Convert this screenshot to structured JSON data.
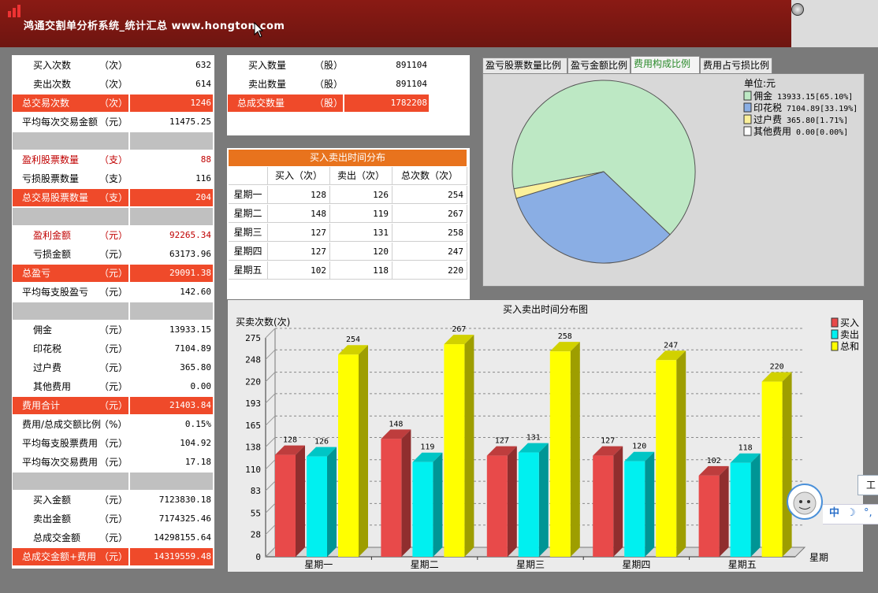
{
  "app": {
    "title": "鸿通交割单分析系统_统计汇总 www.hongton.com"
  },
  "stats": [
    {
      "label": "买入次数",
      "unit": "（次）",
      "value": "632",
      "style": "normal"
    },
    {
      "label": "卖出次数",
      "unit": "（次）",
      "value": "614",
      "style": "normal"
    },
    {
      "label": "总交易次数",
      "unit": "（次）",
      "value": "1246",
      "style": "highlight"
    },
    {
      "label": "平均每次交易金额",
      "unit": "（元）",
      "value": "11475.25",
      "style": "normal"
    },
    {
      "label": "",
      "unit": "",
      "value": "",
      "style": "sep"
    },
    {
      "label": "盈利股票数量",
      "unit": "（支）",
      "value": "88",
      "style": "red"
    },
    {
      "label": "亏损股票数量",
      "unit": "（支）",
      "value": "116",
      "style": "normal"
    },
    {
      "label": "总交易股票数量",
      "unit": "（支）",
      "value": "204",
      "style": "highlight"
    },
    {
      "label": "",
      "unit": "",
      "value": "",
      "style": "sep"
    },
    {
      "label": "盈利金额",
      "unit": "（元）",
      "value": "92265.34",
      "style": "red"
    },
    {
      "label": "亏损金额",
      "unit": "（元）",
      "value": "63173.96",
      "style": "normal"
    },
    {
      "label": "总盈亏",
      "unit": "（元）",
      "value": "29091.38",
      "style": "highlight"
    },
    {
      "label": "平均每支股盈亏",
      "unit": "（元）",
      "value": "142.60",
      "style": "normal"
    },
    {
      "label": "",
      "unit": "",
      "value": "",
      "style": "sep"
    },
    {
      "label": "佣金",
      "unit": "（元）",
      "value": "13933.15",
      "style": "normal"
    },
    {
      "label": "印花税",
      "unit": "（元）",
      "value": "7104.89",
      "style": "normal"
    },
    {
      "label": "过户费",
      "unit": "（元）",
      "value": "365.80",
      "style": "normal"
    },
    {
      "label": "其他费用",
      "unit": "（元）",
      "value": "0.00",
      "style": "normal"
    },
    {
      "label": "费用合计",
      "unit": "（元）",
      "value": "21403.84",
      "style": "highlight"
    },
    {
      "label": "费用/总成交额比例",
      "unit": "（%）",
      "value": "0.15%",
      "style": "normal"
    },
    {
      "label": "平均每支股票费用",
      "unit": "（元）",
      "value": "104.92",
      "style": "normal"
    },
    {
      "label": "平均每次交易费用",
      "unit": "（元）",
      "value": "17.18",
      "style": "normal"
    },
    {
      "label": "",
      "unit": "",
      "value": "",
      "style": "sep"
    },
    {
      "label": "买入金额",
      "unit": "（元）",
      "value": "7123830.18",
      "style": "normal"
    },
    {
      "label": "卖出金额",
      "unit": "（元）",
      "value": "7174325.46",
      "style": "normal"
    },
    {
      "label": "总成交金额",
      "unit": "（元）",
      "value": "14298155.64",
      "style": "normal"
    },
    {
      "label": "总成交金额+费用",
      "unit": "（元）",
      "value": "14319559.48",
      "style": "highlight"
    }
  ],
  "quantity": [
    {
      "label": "买入数量",
      "unit": "（股）",
      "value": "891104",
      "style": "normal"
    },
    {
      "label": "卖出数量",
      "unit": "（股）",
      "value": "891104",
      "style": "normal"
    },
    {
      "label": "总成交数量",
      "unit": "（股）",
      "value": "1782208",
      "style": "highlight"
    }
  ],
  "time_table": {
    "title": "买入卖出时间分布",
    "headers": [
      "",
      "买入（次）",
      "卖出（次）",
      "总次数（次）"
    ],
    "rows": [
      [
        "星期一",
        "128",
        "126",
        "254"
      ],
      [
        "星期二",
        "148",
        "119",
        "267"
      ],
      [
        "星期三",
        "127",
        "131",
        "258"
      ],
      [
        "星期四",
        "127",
        "120",
        "247"
      ],
      [
        "星期五",
        "102",
        "118",
        "220"
      ]
    ]
  },
  "tabs": [
    {
      "label": "盈亏股票数量比例",
      "active": false
    },
    {
      "label": "盈亏金额比例",
      "active": false
    },
    {
      "label": "费用构成比例",
      "active": true
    },
    {
      "label": "费用占亏损比例",
      "active": false
    }
  ],
  "ime": {
    "tip": "工",
    "cn": "中",
    "moon": "☽",
    "dots": "°,"
  },
  "chart_data": [
    {
      "type": "pie",
      "unit_label": "单位:元",
      "slices": [
        {
          "name": "佣金",
          "value": 13933.15,
          "pct": "65.10%",
          "label": "13933.15[65.10%]",
          "color": "#bde8c4"
        },
        {
          "name": "印花税",
          "value": 7104.89,
          "pct": "33.19%",
          "label": "7104.89[33.19%]",
          "color": "#8aaee4"
        },
        {
          "name": "过户费",
          "value": 365.8,
          "pct": "1.71%",
          "label": "365.80[1.71%]",
          "color": "#fbf09a"
        },
        {
          "name": "其他费用",
          "value": 0.0,
          "pct": "0.00%",
          "label": "0.00[0.00%]",
          "color": "#ffffff"
        }
      ]
    },
    {
      "type": "bar",
      "title": "买入卖出时间分布图",
      "ylabel": "买卖次数(次)",
      "xlabel": "星期",
      "categories": [
        "星期一",
        "星期二",
        "星期三",
        "星期四",
        "星期五"
      ],
      "series": [
        {
          "name": "买入",
          "values": [
            128,
            148,
            127,
            127,
            102
          ],
          "color": "#e84a4a"
        },
        {
          "name": "卖出",
          "values": [
            126,
            119,
            131,
            120,
            118
          ],
          "color": "#00f0f0"
        },
        {
          "name": "总和",
          "values": [
            254,
            267,
            258,
            247,
            220
          ],
          "color": "#ffff00"
        }
      ],
      "yticks": [
        0,
        28,
        55,
        83,
        110,
        138,
        165,
        193,
        220,
        248,
        275
      ],
      "ylim": [
        0,
        275
      ],
      "grid": true,
      "legend": "top-right"
    }
  ]
}
